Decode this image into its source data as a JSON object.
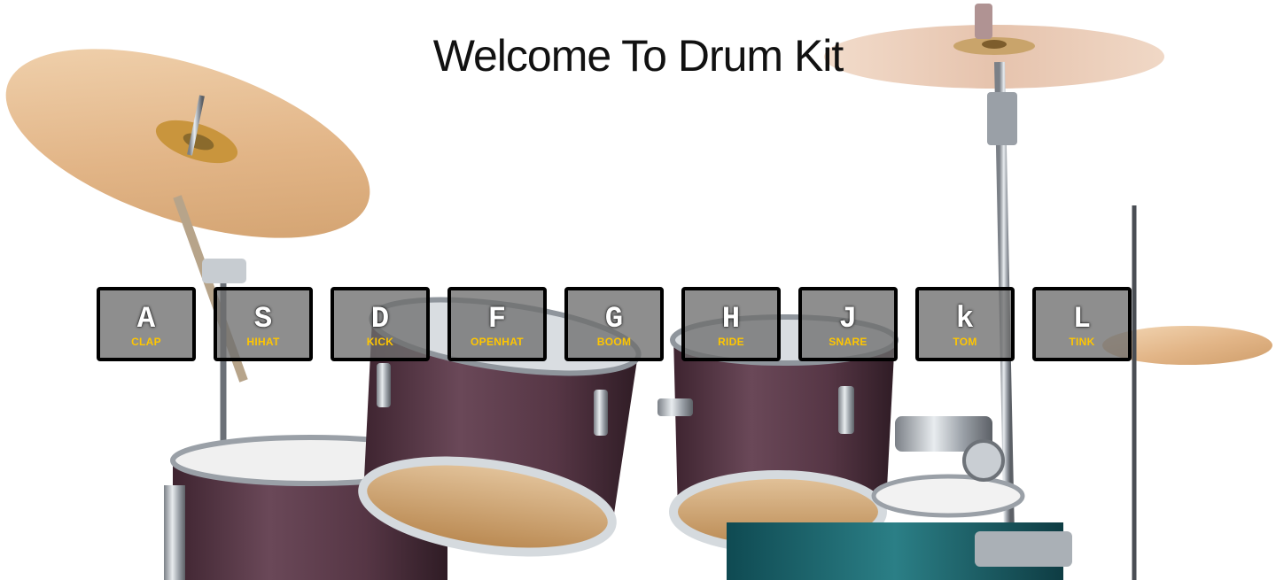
{
  "page": {
    "title": "Welcome To Drum Kit"
  },
  "background": {
    "image": "drum-kit-photo",
    "colors": {
      "cymbal": "#e3b98a",
      "shell": "#5a3844",
      "chrome": "#b9bfc6",
      "head": "#c9965f"
    }
  },
  "keys": [
    {
      "letter": "A",
      "sound": "CLAP"
    },
    {
      "letter": "S",
      "sound": "HIHAT"
    },
    {
      "letter": "D",
      "sound": "KICK"
    },
    {
      "letter": "F",
      "sound": "OPENHAT"
    },
    {
      "letter": "G",
      "sound": "BOOM"
    },
    {
      "letter": "H",
      "sound": "RIDE"
    },
    {
      "letter": "J",
      "sound": "SNARE"
    },
    {
      "letter": "k",
      "sound": "TOM"
    },
    {
      "letter": "L",
      "sound": "TINK"
    }
  ],
  "theme": {
    "key_border": "#000000",
    "key_fill": "#6e6e6e",
    "key_letter": "#ffffff",
    "sound_label": "#ffc600"
  }
}
